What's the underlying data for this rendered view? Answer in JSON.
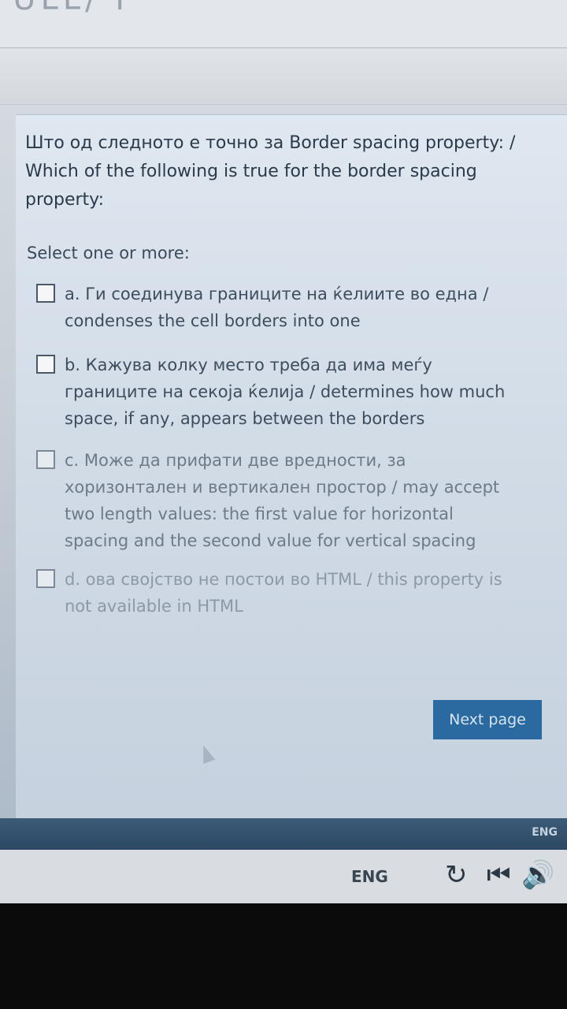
{
  "header": {
    "title_fragment": "ᐧUᒪᒪ/ Ⅰ"
  },
  "question": {
    "text_line1": "Што од следното е точно за Border spacing property: /",
    "text_line2": "Which of the following is true for the border spacing",
    "text_line3": "property:",
    "instruction": "Select one or more:"
  },
  "options": [
    {
      "label": "a. Ги соединува границите на ќелиите во една / condenses the cell borders into one"
    },
    {
      "label": "b. Кажува колку место треба да има меѓу границите на секоја ќелија / determines how much space, if any, appears between the borders"
    },
    {
      "label": "c. Може да прифати две вредности, за хоризонтален и вертикален простор / may accept two length values: the first value for horizontal spacing and the second value for vertical spacing"
    },
    {
      "label": "d. ова својство не постои во HTML / this property is not available in HTML"
    }
  ],
  "buttons": {
    "next_page": "Next page"
  },
  "taskbar": {
    "lang_small": "ENG"
  },
  "bottombar": {
    "lang": "ENG"
  },
  "icons": [
    "refresh-icon",
    "skip-back-icon",
    "speaker-icon"
  ]
}
